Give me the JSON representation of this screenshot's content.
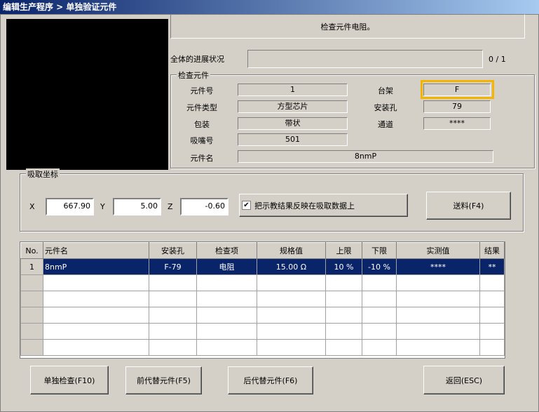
{
  "title": "编辑生产程序 > 单独验证元件",
  "message": "检查元件电阻。",
  "progress": {
    "label": "全体的进展状况",
    "value": "0 / 1",
    "fraction": 0
  },
  "component": {
    "group_title": "检查元件",
    "part_no_label": "元件号",
    "part_no": "1",
    "type_label": "元件类型",
    "type": "方型芯片",
    "package_label": "包装",
    "package": "带状",
    "nozzle_label": "吸嘴号",
    "nozzle": "501",
    "name_label": "元件名",
    "name": "8nmP",
    "rack_label": "台架",
    "rack": "F",
    "hole_label": "安装孔",
    "hole": "79",
    "channel_label": "通道",
    "channel": "****"
  },
  "pickup": {
    "group_title": "吸取坐标",
    "x_label": "X",
    "x": "667.90",
    "y_label": "Y",
    "y": "5.00",
    "z_label": "Z",
    "z": "-0.60",
    "reflect_label": "把示教结果反映在吸取数据上",
    "reflect_checked": true,
    "feed_label": "送料(F4)"
  },
  "table": {
    "headers": [
      "No.",
      "元件名",
      "安装孔",
      "检查项",
      "规格值",
      "上限",
      "下限",
      "实测值",
      "结果"
    ],
    "rows": [
      [
        "1",
        "8nmP",
        "F-79",
        "电阻",
        "15.00 Ω",
        "10 %",
        "-10 %",
        "****",
        "**"
      ]
    ]
  },
  "buttons": {
    "single": "单独检查(F10)",
    "prev": "前代替元件(F5)",
    "next": "后代替元件(F6)",
    "back": "返回(ESC)"
  },
  "colors": {
    "highlight": "#f5b400",
    "selection": "#0a246a"
  }
}
